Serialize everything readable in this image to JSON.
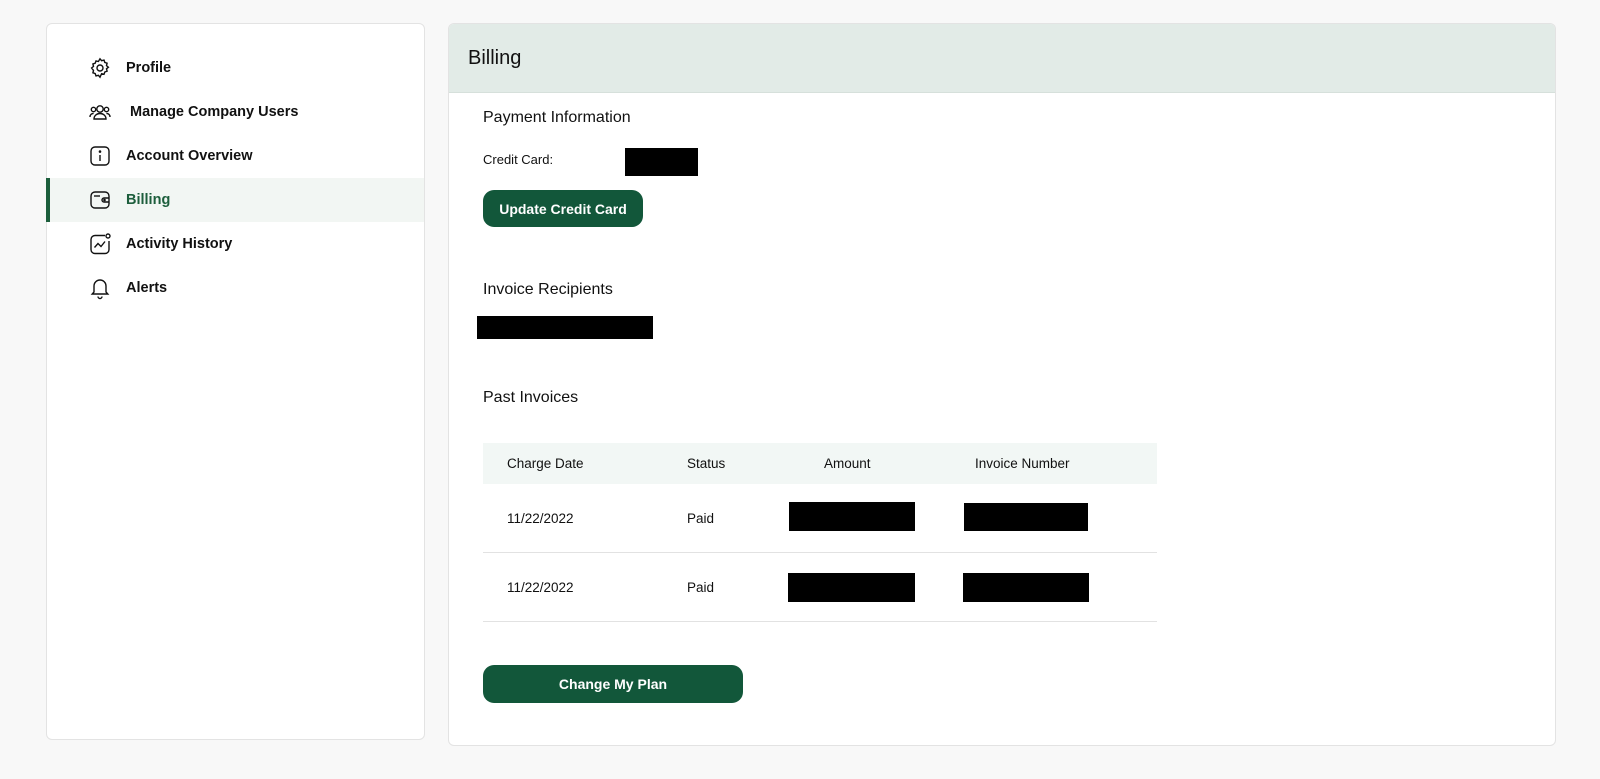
{
  "sidebar": {
    "items": [
      {
        "label": "Profile",
        "icon": "gear-icon",
        "active": false
      },
      {
        "label": "Manage Company Users",
        "icon": "users-icon",
        "active": false
      },
      {
        "label": "Account Overview",
        "icon": "info-icon",
        "active": false
      },
      {
        "label": "Billing",
        "icon": "wallet-icon",
        "active": true
      },
      {
        "label": "Activity History",
        "icon": "activity-chart-icon",
        "active": false
      },
      {
        "label": "Alerts",
        "icon": "bell-icon",
        "active": false
      }
    ]
  },
  "main": {
    "title": "Billing",
    "payment": {
      "title": "Payment Information",
      "credit_card_label": "Credit Card:",
      "update_button": "Update Credit Card"
    },
    "recipients": {
      "title": "Invoice Recipients"
    },
    "invoices": {
      "title": "Past Invoices",
      "columns": [
        "Charge Date",
        "Status",
        "Amount",
        "Invoice Number"
      ],
      "rows": [
        {
          "charge_date": "11/22/2022",
          "status": "Paid"
        },
        {
          "charge_date": "11/22/2022",
          "status": "Paid"
        }
      ]
    },
    "change_plan_button": "Change My Plan"
  },
  "colors": {
    "accent": "#12573a",
    "header_bg": "#e2ebe7",
    "active_bg": "#f2f6f3"
  }
}
